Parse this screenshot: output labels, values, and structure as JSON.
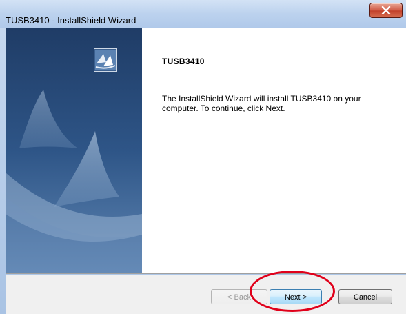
{
  "window": {
    "title": "TUSB3410 - InstallShield Wizard",
    "close_glyph": "X"
  },
  "content": {
    "heading": "TUSB3410",
    "body": "The InstallShield Wizard will install TUSB3410 on your computer.  To continue, click Next."
  },
  "buttons": {
    "back_label": "< Back",
    "next_label": "Next >",
    "cancel_label": "Cancel"
  },
  "colors": {
    "highlight": "#e0001a",
    "side_panel": "#2d4f7e"
  },
  "icons": [
    "close-icon",
    "installshield-logo-icon"
  ]
}
